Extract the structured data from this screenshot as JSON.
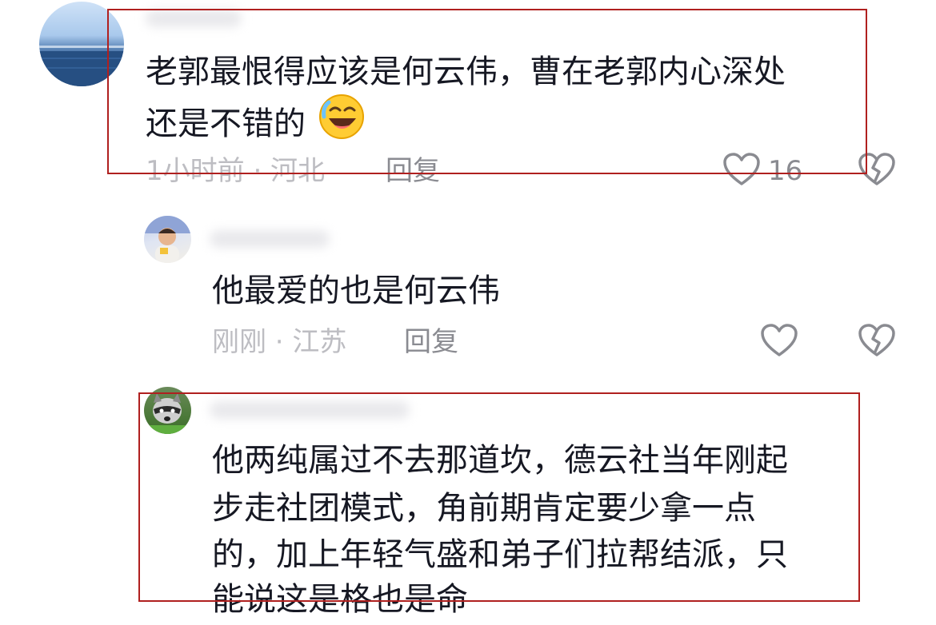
{
  "comments": [
    {
      "text_line1": "老郭最恨得应该是何云伟，曹在老郭内心深处",
      "text_line2": "还是不错的",
      "emoji": "grinning-sweat-emoji",
      "meta": "1小时前 · 河北",
      "reply_label": "回复",
      "like_count": "16"
    },
    {
      "text_line1": "他最爱的也是何云伟",
      "meta": "刚刚 · 江苏",
      "reply_label": "回复"
    },
    {
      "text_line1": "他两纯属过不去那道坎，德云社当年刚起",
      "text_line2": "步走社团模式，角前期肯定要少拿一点",
      "text_line3": "的，加上年轻气盛和弟子们拉帮结派，只",
      "text_line4": "能说这是格也是命"
    }
  ],
  "colors": {
    "highlight_border": "#b0201f",
    "text": "#161823",
    "meta": "#bdbdc2",
    "reply": "#8a8b91"
  }
}
